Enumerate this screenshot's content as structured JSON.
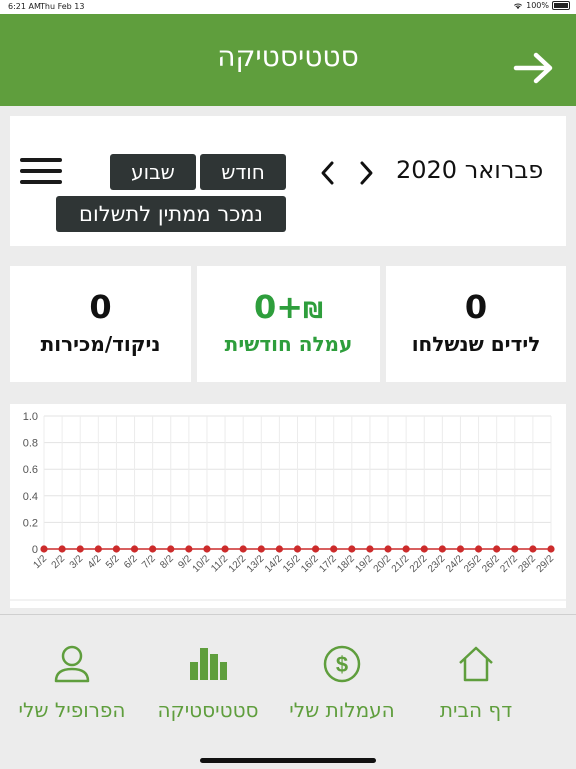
{
  "status_bar": {
    "time": "6:21 AM",
    "date": "Thu Feb 13",
    "battery": "100%"
  },
  "header": {
    "title": "סטטיסטיקה"
  },
  "controls": {
    "week_label": "שבוע",
    "month_label": "חודש",
    "pending_label": "נמכר ממתין לתשלום",
    "current_month": "פברואר 2020"
  },
  "stats": {
    "leads": {
      "value": "0",
      "label": "לידים שנשלחו"
    },
    "commission": {
      "currency": "₪",
      "value": "0+",
      "label": "עמלה חודשית"
    },
    "points": {
      "value": "0",
      "label": "ניקוד/מכירות"
    }
  },
  "chart_data": {
    "type": "line",
    "x": [
      "1/2",
      "2/2",
      "3/2",
      "4/2",
      "5/2",
      "6/2",
      "7/2",
      "8/2",
      "9/2",
      "10/2",
      "11/2",
      "12/2",
      "13/2",
      "14/2",
      "15/2",
      "16/2",
      "17/2",
      "18/2",
      "19/2",
      "20/2",
      "21/2",
      "22/2",
      "23/2",
      "24/2",
      "25/2",
      "26/2",
      "27/2",
      "28/2",
      "29/2"
    ],
    "series": [
      {
        "values": [
          0,
          0,
          0,
          0,
          0,
          0,
          0,
          0,
          0,
          0,
          0,
          0,
          0,
          0,
          0,
          0,
          0,
          0,
          0,
          0,
          0,
          0,
          0,
          0,
          0,
          0,
          0,
          0,
          0
        ],
        "color": "#cc2b2b"
      }
    ],
    "y_ticks": [
      "0",
      "0.2",
      "0.4",
      "0.6",
      "0.8",
      "1.0"
    ],
    "ylim": [
      0,
      1
    ],
    "grid": true,
    "title": "",
    "xlabel": "",
    "ylabel": ""
  },
  "bottom_nav": {
    "home": "דף הבית",
    "commissions": "העמלות שלי",
    "statistics": "סטטיסטיקה",
    "profile": "הפרופיל שלי"
  },
  "colors": {
    "brand": "#5f9e3d",
    "positive": "#2e9e3c",
    "dark_button": "#2f3535"
  }
}
